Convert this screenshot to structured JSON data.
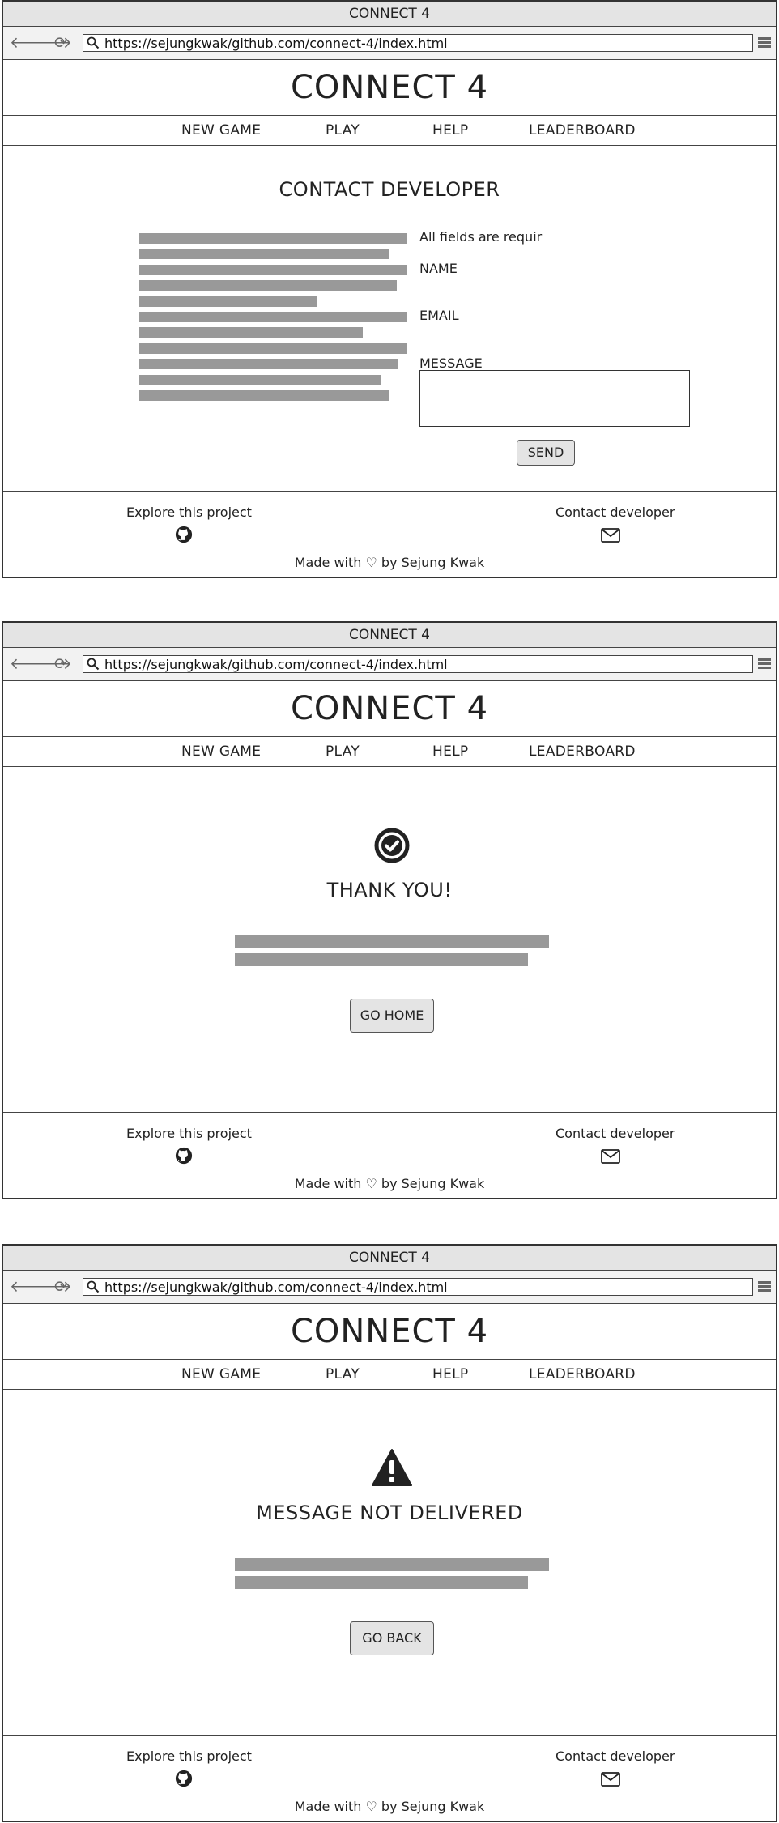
{
  "browser": {
    "title": "CONNECT 4",
    "url": "https://sejungkwak/github.com/connect-4/index.html"
  },
  "site": {
    "brand": "CONNECT 4",
    "nav": {
      "new_game": "NEW GAME",
      "play": "PLAY",
      "help": "HELP",
      "leaderboard": "LEADERBOARD"
    },
    "footer": {
      "explore": "Explore this project",
      "contact": "Contact developer",
      "made_prefix": "Made with",
      "made_heart": "♡",
      "made_suffix": "by Sejung Kwak"
    }
  },
  "contact_page": {
    "heading": "CONTACT DEVELOPER",
    "required_note": "All fields are requir",
    "name_label": "NAME",
    "email_label": "EMAIL",
    "message_label": "MESSAGE",
    "send_label": "SEND"
  },
  "thanks_page": {
    "heading": "THANK YOU!",
    "button_label": "GO HOME"
  },
  "error_page": {
    "heading": "MESSAGE NOT DELIVERED",
    "button_label": "GO BACK"
  },
  "icons": {
    "success": "check-circle-icon",
    "error": "warning-triangle-icon",
    "footer_left": "github-icon",
    "footer_right": "envelope-icon"
  }
}
